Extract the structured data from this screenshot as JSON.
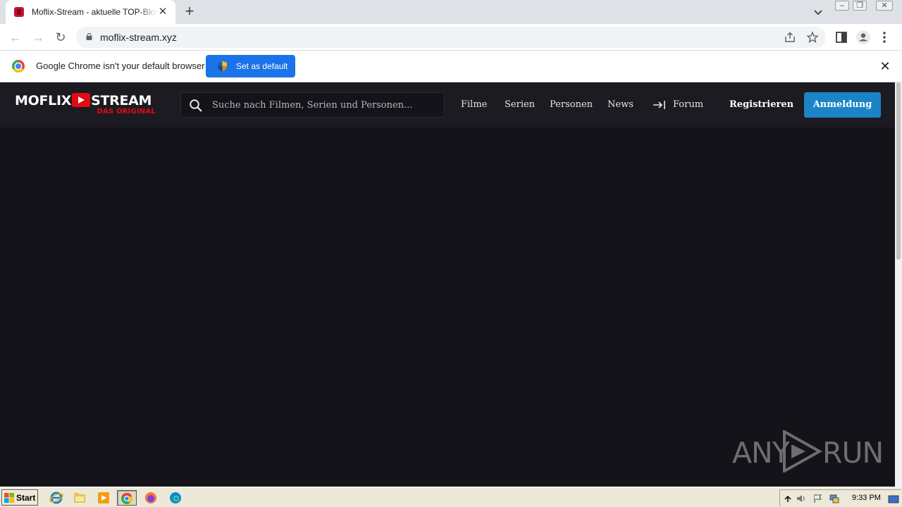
{
  "browser": {
    "tab_title": "Moflix-Stream - aktuelle TOP-Blockbuster",
    "tab_close": "✕",
    "new_tab": "+",
    "url": "moflix-stream.xyz",
    "back": "←",
    "forward": "→",
    "reload": "↻"
  },
  "infobar": {
    "message": "Google Chrome isn't your default browser",
    "button_label": "Set as default",
    "close": "✕"
  },
  "site": {
    "logo_main_left": "MOFLIX",
    "logo_main_right": "STREAM",
    "logo_sub": "DAS ORIGINAL",
    "search_placeholder": "Suche nach Filmen, Serien und Personen...",
    "nav": [
      "Filme",
      "Serien",
      "Personen",
      "News",
      "Forum"
    ],
    "register": "Registrieren",
    "login": "Anmeldung",
    "accent_color": "#1b84c6",
    "brand_color": "#e50914"
  },
  "watermark": {
    "left": "ANY",
    "right": "RUN"
  },
  "taskbar": {
    "start_label": "Start",
    "clock": "9:33 PM"
  }
}
